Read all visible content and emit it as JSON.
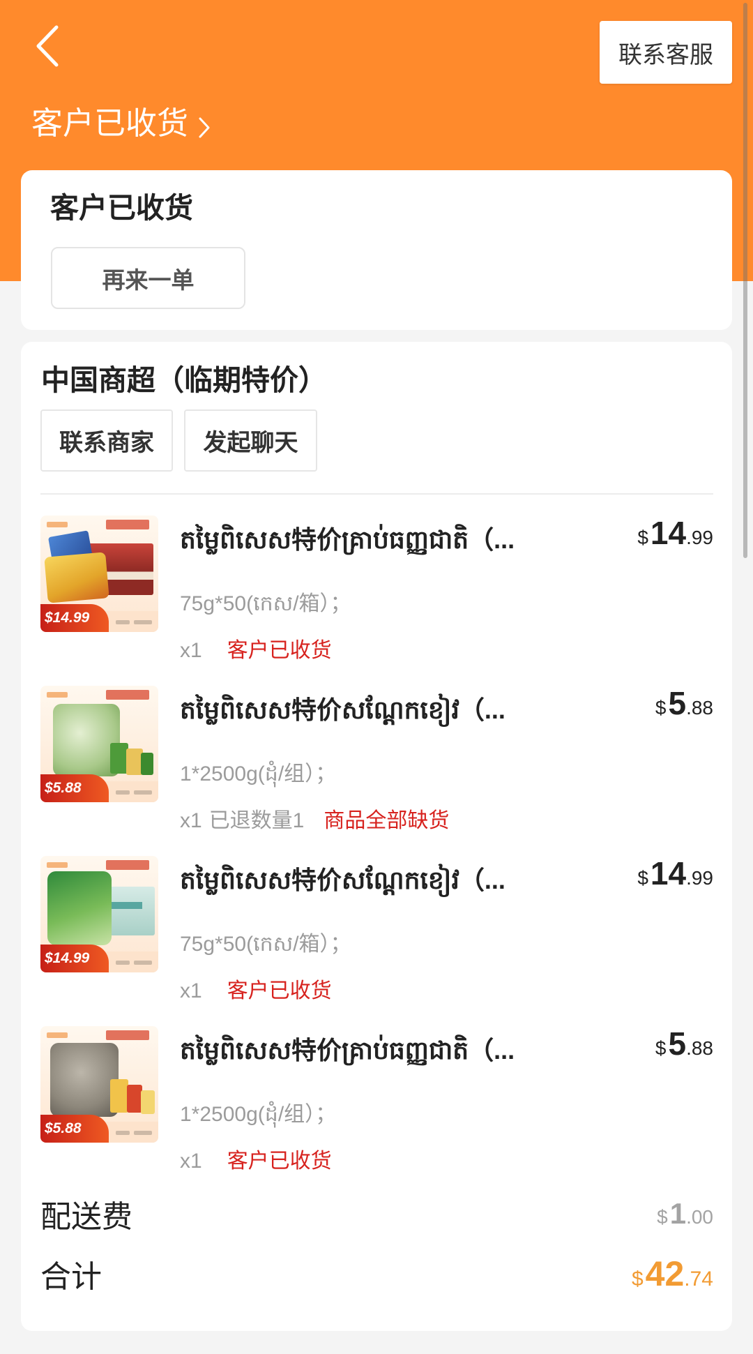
{
  "header": {
    "back_icon": "chevron-left-icon",
    "service_button": "联系客服",
    "status_title": "客户已收货",
    "status_chevron_icon": "chevron-right-icon"
  },
  "status_card": {
    "title": "客户已收货",
    "reorder_button": "再来一单"
  },
  "store": {
    "name": "中国商超（临期特价）",
    "contact_button": "联系商家",
    "chat_button": "发起聊天"
  },
  "items": [
    {
      "title": "តម្លៃពិសេស特价គ្រាប់ធញ្ញជាតិ（...",
      "price": {
        "currency": "$",
        "integer": "14",
        "decimal": ".99"
      },
      "spec": "75g*50(កេស/箱）；",
      "qty": "x1",
      "status": "客户已收货",
      "thumb_badge": "$14.99"
    },
    {
      "title": "តម្លៃពិសេស特价សណ្តែកខៀវ（...",
      "price": {
        "currency": "$",
        "integer": "5",
        "decimal": ".88"
      },
      "spec": "1*2500g(ដុំ/组）；",
      "qty": "x1",
      "refund": "已退数量1",
      "status": "商品全部缺货",
      "thumb_badge": "$5.88"
    },
    {
      "title": "តម្លៃពិសេស特价សណ្តែកខៀវ（...",
      "price": {
        "currency": "$",
        "integer": "14",
        "decimal": ".99"
      },
      "spec": "75g*50(កេស/箱）；",
      "qty": "x1",
      "status": "客户已收货",
      "thumb_badge": "$14.99"
    },
    {
      "title": "តម្លៃពិសេស特价គ្រាប់ធញ្ញជាតិ（...",
      "price": {
        "currency": "$",
        "integer": "5",
        "decimal": ".88"
      },
      "spec": "1*2500g(ដុំ/组）；",
      "qty": "x1",
      "status": "客户已收货",
      "thumb_badge": "$5.88"
    }
  ],
  "fees": {
    "delivery": {
      "label": "配送费",
      "currency": "$",
      "integer": "1",
      "decimal": ".00"
    },
    "total": {
      "label": "合计",
      "currency": "$",
      "integer": "42",
      "decimal": ".74"
    }
  },
  "colors": {
    "header_orange": "#FF8A2C",
    "status_red": "#D7221E",
    "total_orange": "#F29B33"
  }
}
